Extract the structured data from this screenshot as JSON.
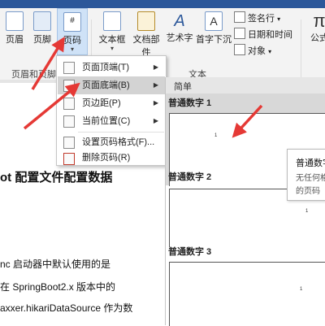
{
  "ribbon": {
    "buttons": {
      "header": "页眉",
      "footer": "页脚",
      "page_number": "页码",
      "textbox": "文本框",
      "doc_parts": "文档部件",
      "wordart": "艺术字",
      "dropcap": "首字下沉",
      "formula": "公式"
    },
    "small_buttons": {
      "signature": "签名行",
      "datetime": "日期和时间",
      "object": "对象"
    },
    "groups": {
      "header_footer": "页眉和页脚",
      "text": "文本"
    }
  },
  "menu": {
    "items": [
      {
        "label": "页面顶端(T)",
        "has_submenu": true
      },
      {
        "label": "页面底端(B)",
        "has_submenu": true
      },
      {
        "label": "页边距(P)",
        "has_submenu": true
      },
      {
        "label": "当前位置(C)",
        "has_submenu": true
      },
      {
        "label": "设置页码格式(F)...",
        "has_submenu": false
      },
      {
        "label": "删除页码(R)",
        "has_submenu": false
      }
    ]
  },
  "gallery": {
    "header": "简单",
    "items": [
      {
        "title": "普通数字 1",
        "number": "1"
      },
      {
        "title": "普通数字 2",
        "number": "1"
      },
      {
        "title": "普通数字 3",
        "number": "1"
      }
    ]
  },
  "tooltip": {
    "title": "普通数字",
    "line1": "无任何格",
    "line2": "的页码"
  },
  "document": {
    "heading": "ot 配置文件配置数据",
    "line1": "nc 启动器中默认使用的是",
    "line2": "在 SpringBoot2.x 版本中的",
    "line3": "axxer.hikariDataSource 作为数"
  },
  "colors": {
    "accent": "#2b579a",
    "arrow": "#e53935",
    "highlight": "#cfe2f7"
  }
}
